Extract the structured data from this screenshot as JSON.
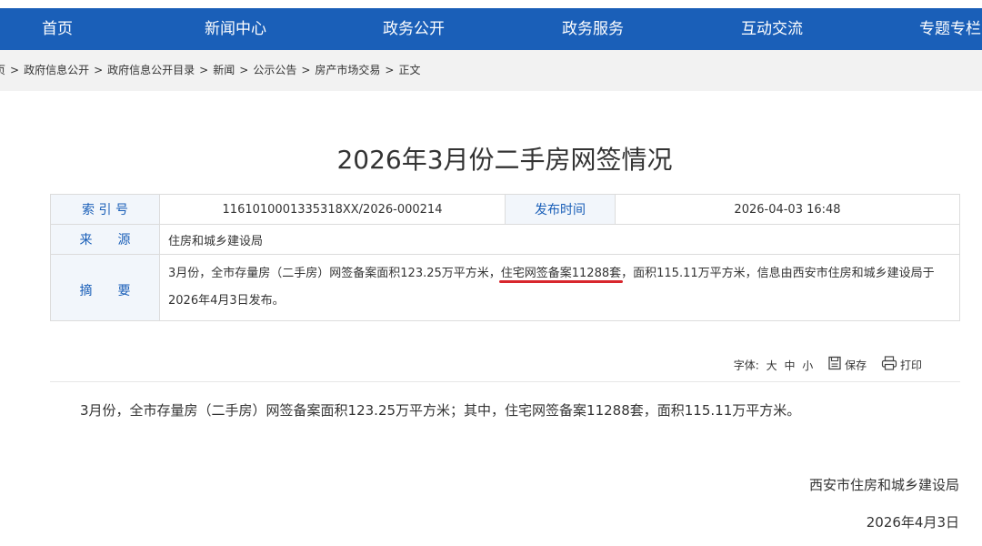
{
  "nav": {
    "items": [
      "首页",
      "新闻中心",
      "政务公开",
      "政务服务",
      "互动交流",
      "专题专栏"
    ]
  },
  "breadcrumb": {
    "items": [
      "页",
      "政府信息公开",
      "政府信息公开目录",
      "新闻",
      "公示公告",
      "房产市场交易",
      "正文"
    ],
    "separator": ">"
  },
  "article": {
    "title": "2026年3月份二手房网签情况",
    "meta": {
      "index_label": "索 引 号",
      "index_value": "1161010001335318XX/2026-000214",
      "publish_label": "发布时间",
      "publish_value": "2026-04-03 16:48",
      "source_label": "来　　源",
      "source_value": "住房和城乡建设局",
      "summary_label": "摘　　要",
      "summary_part1": "3月份，全市存量房（二手房）网签备案面积123.25万平方米，",
      "summary_highlight": "住宅网签备案11288套",
      "summary_part2": "，面积115.11万平方米，信息由西安市住房和城乡建设局于2026年4月3日发布。"
    },
    "tools": {
      "font_label": "字体:",
      "font_large": "大",
      "font_medium": "中",
      "font_small": "小",
      "save_label": "保存",
      "print_label": "打印"
    },
    "body": "3月份，全市存量房（二手房）网签备案面积123.25万平方米；其中，住宅网签备案11288套，面积115.11万平方米。",
    "signature_org": "西安市住房和城乡建设局",
    "signature_date": "2026年4月3日"
  },
  "colors": {
    "nav_bg": "#1a5fb8",
    "label_text": "#1a5fb8",
    "highlight_underline": "#d8262d"
  }
}
